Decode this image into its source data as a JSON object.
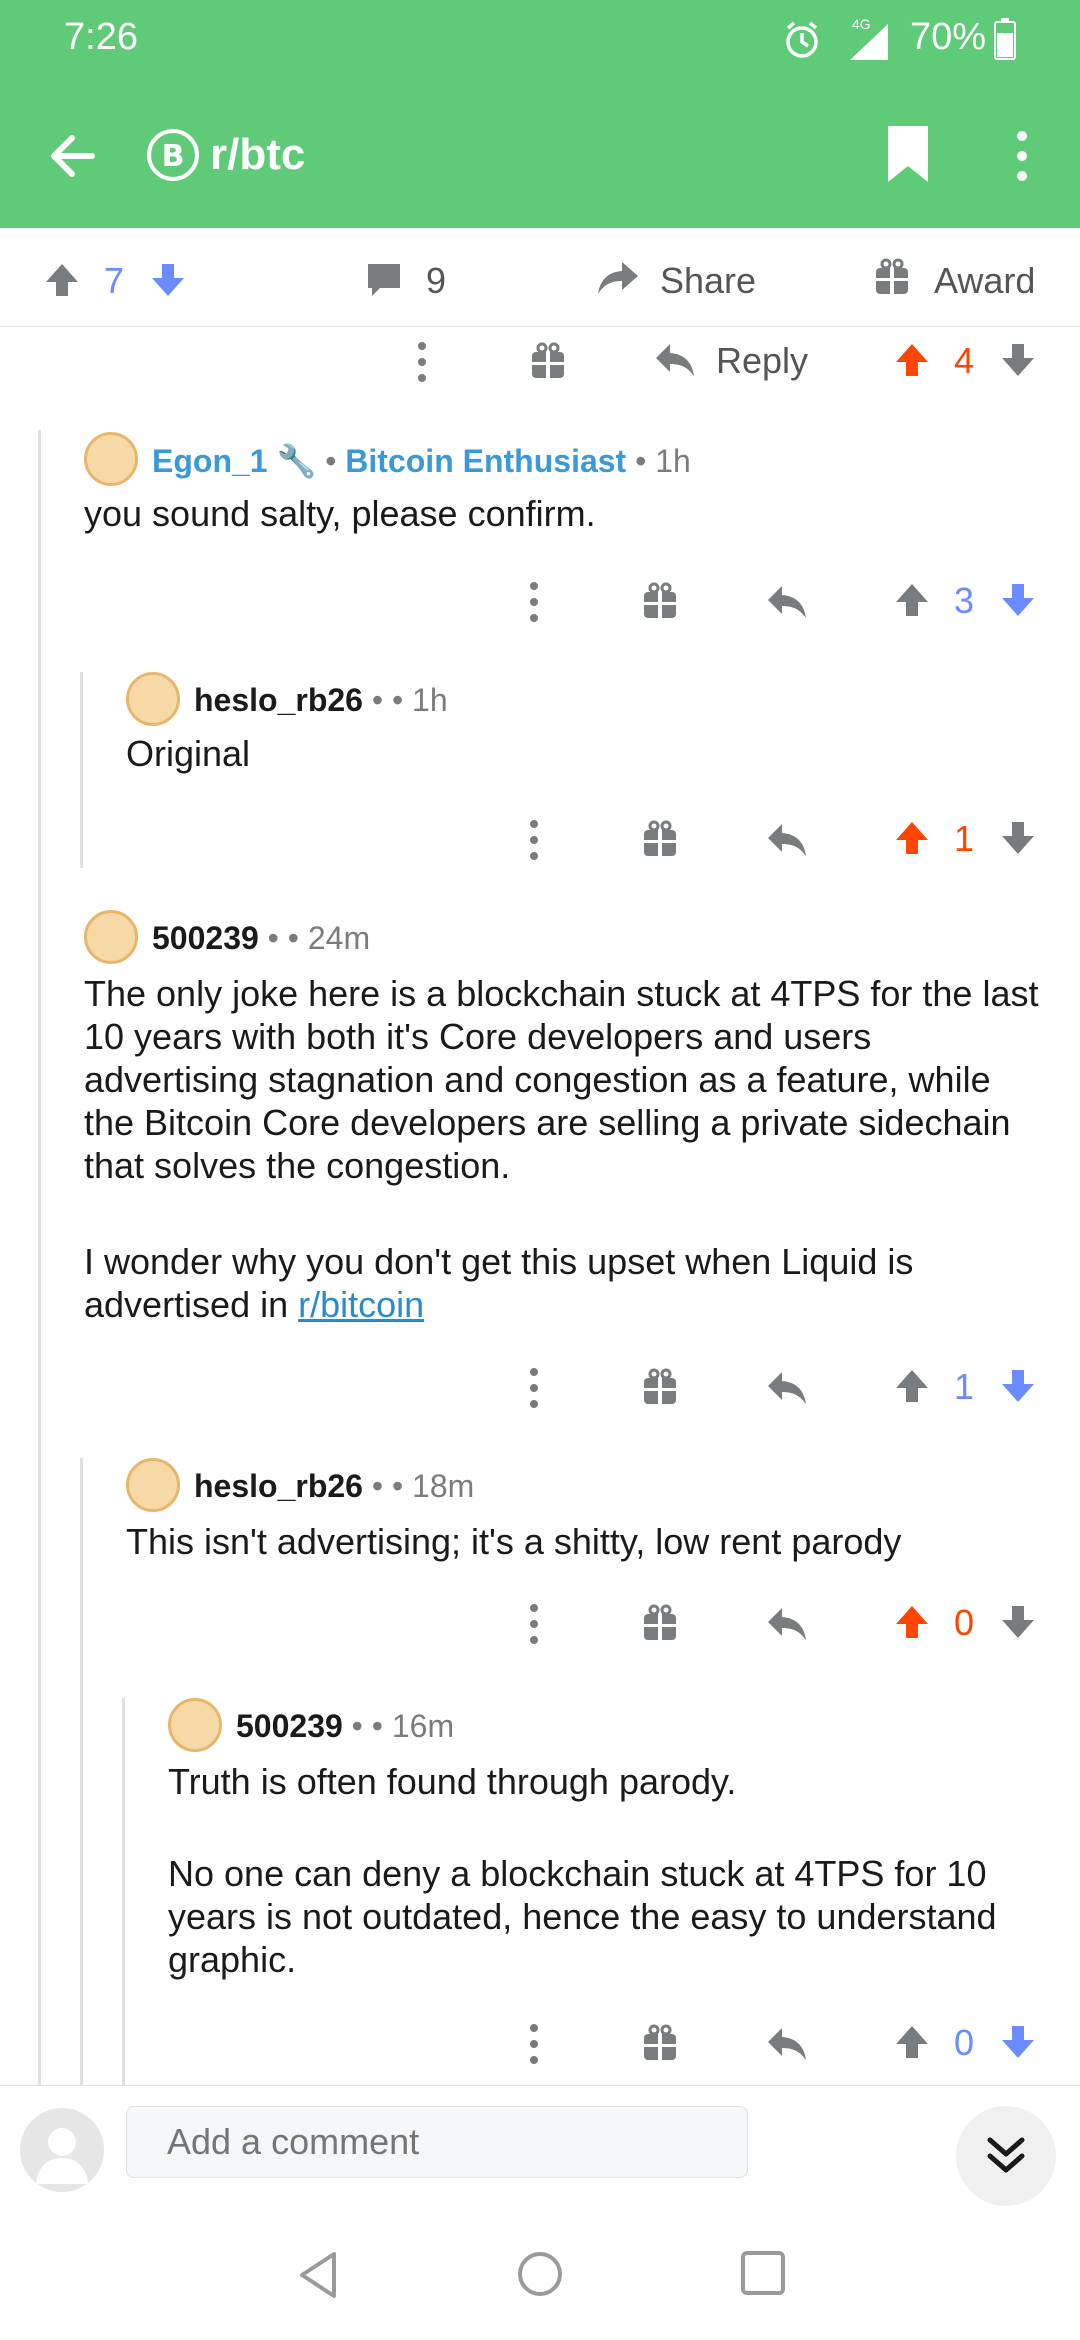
{
  "status_bar": {
    "time": "7:26",
    "battery": "70%",
    "network": "4G"
  },
  "app_bar": {
    "subreddit": "r/btc"
  },
  "post_actions": {
    "score": "7",
    "comments": "9",
    "share_label": "Share",
    "award_label": "Award"
  },
  "top_reply": {
    "reply_label": "Reply",
    "score": "4"
  },
  "comments": [
    {
      "author": "Egon_1",
      "flair": "Bitcoin Enthusiast",
      "sep": "•",
      "time": "1h",
      "body": "you sound salty, please confirm.",
      "score": "3"
    },
    {
      "author": "heslo_rb26",
      "sep": "• •",
      "time": "1h",
      "body": "Original",
      "score": "1"
    },
    {
      "author": "500239",
      "sep": "• •",
      "time": "24m",
      "body_p1": "The only joke here is a blockchain stuck at 4TPS for the last 10 years with both it's Core developers and users advertising stagnation and congestion as a feature, while the Bitcoin Core developers are selling a private sidechain that solves the congestion.",
      "body_p2": "I wonder why you don't get this upset when Liquid is advertised in ",
      "link": "r/bitcoin",
      "score": "1"
    },
    {
      "author": "heslo_rb26",
      "sep": "• •",
      "time": "18m",
      "body": "This isn't advertising; it's a shitty, low rent parody",
      "score": "0"
    },
    {
      "author": "500239",
      "sep": "• •",
      "time": "16m",
      "body_p1": "Truth is often found through parody.",
      "body_p2": "No one can deny a blockchain stuck at 4TPS for 10 years is not outdated, hence the easy to understand graphic.",
      "score": "0"
    }
  ],
  "composer": {
    "placeholder": "Add a comment"
  },
  "colors": {
    "header_green": "#5fcb79",
    "upvote_orange": "#ff4500",
    "vote_blue": "#6b8cff",
    "link_blue": "#3a9ad9"
  }
}
